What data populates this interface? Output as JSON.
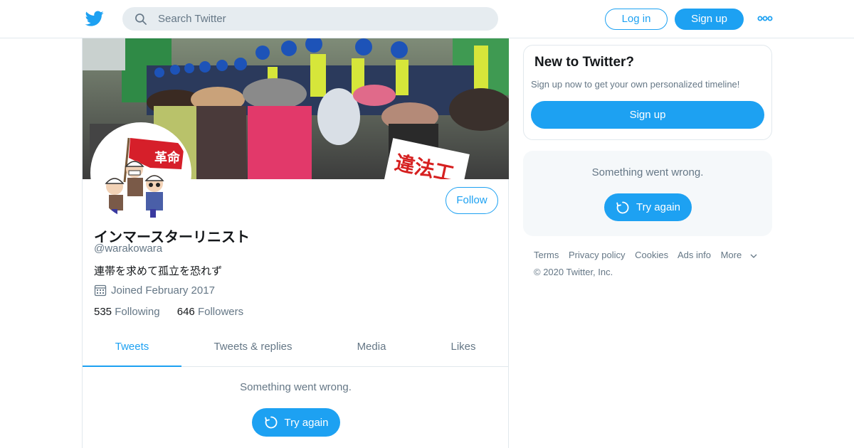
{
  "header": {
    "search_placeholder": "Search Twitter",
    "login_label": "Log in",
    "signup_label": "Sign up",
    "logo_icon": "twitter-bird-icon",
    "more_icon": "more-dots-icon"
  },
  "profile": {
    "display_name": "インマースターリニスト",
    "handle": "@warakowara",
    "bio": "連帯を求めて孤立を恐れず",
    "joined": "Joined February 2017",
    "following_count": "535",
    "following_label": "Following",
    "followers_count": "646",
    "followers_label": "Followers",
    "follow_label": "Follow",
    "avatar_flag_text": "革命",
    "banner_sign_text": "違法工"
  },
  "tabs": [
    {
      "label": "Tweets",
      "active": true
    },
    {
      "label": "Tweets & replies",
      "active": false
    },
    {
      "label": "Media",
      "active": false
    },
    {
      "label": "Likes",
      "active": false
    }
  ],
  "timeline": {
    "error_text": "Something went wrong.",
    "retry_label": "Try again"
  },
  "sidebar": {
    "new_title": "New to Twitter?",
    "new_subtitle": "Sign up now to get your own personalized timeline!",
    "signup_label": "Sign up",
    "error_text": "Something went wrong.",
    "retry_label": "Try again"
  },
  "footer": {
    "links": [
      "Terms",
      "Privacy policy",
      "Cookies",
      "Ads info",
      "More"
    ],
    "copyright": "© 2020 Twitter, Inc."
  },
  "colors": {
    "accent": "#1da1f2",
    "text_secondary": "#657786",
    "border": "#e1e8ed"
  }
}
